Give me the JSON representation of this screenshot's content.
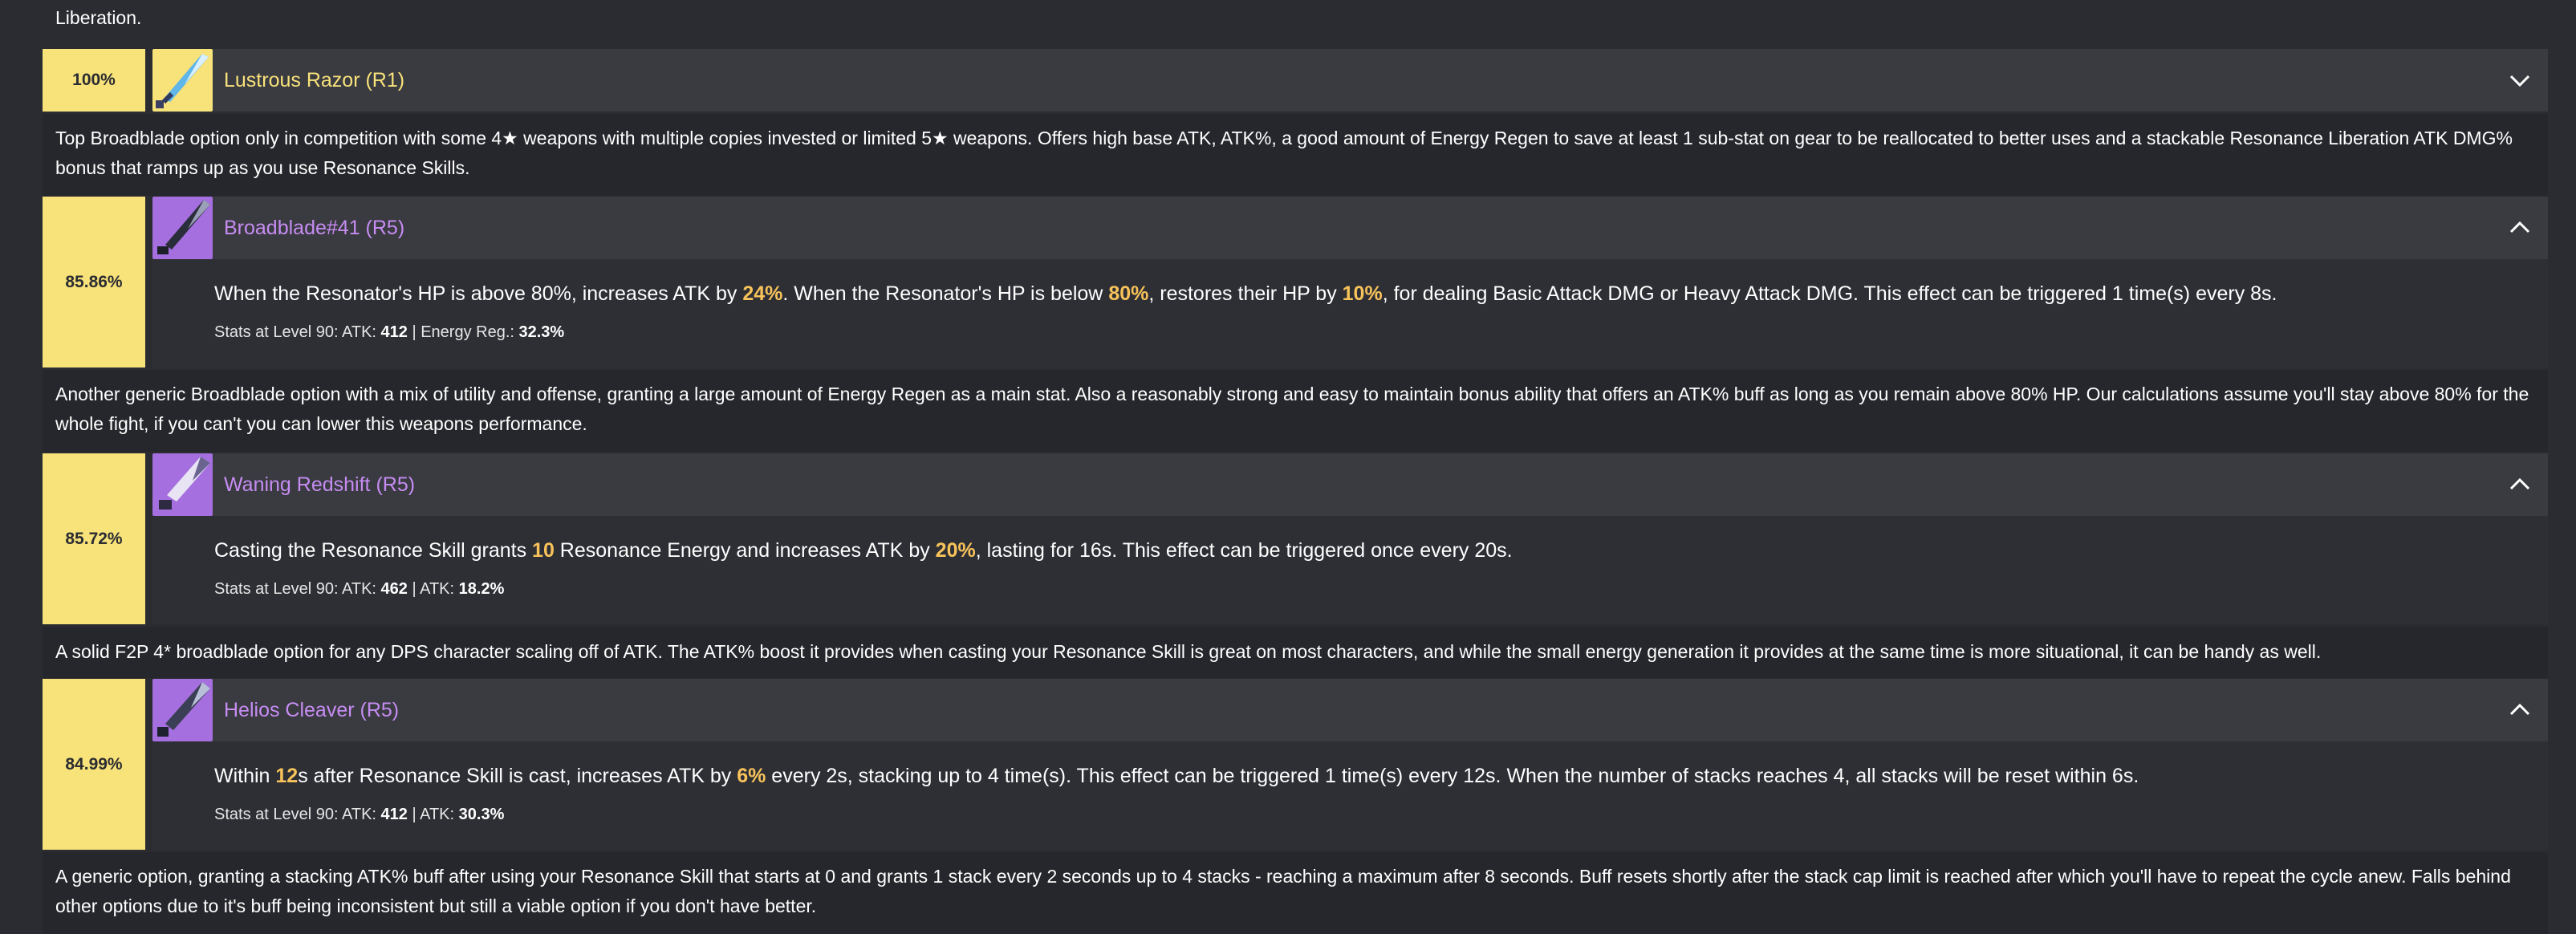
{
  "intro_tail": "Liberation.",
  "weapons": [
    {
      "percent": "100%",
      "name": "Lustrous Razor (R1)",
      "rarity": "5",
      "expanded": false,
      "effect": "",
      "description": "Top Broadblade option only in competition with some 4★ weapons with multiple copies invested or limited 5★ weapons. Offers high base ATK, ATK%, a good amount of Energy Regen to save at least 1 sub-stat on gear to be reallocated to better uses and a stackable Resonance Liberation ATK DMG% bonus that ramps up as you use Resonance Skills."
    },
    {
      "percent": "85.86%",
      "name": "Broadblade#41 (R5)",
      "rarity": "4",
      "expanded": true,
      "effect_parts": [
        "When the Resonator's HP is above 80%, increases ATK by ",
        "24%",
        ". When the Resonator's HP is below ",
        "80%",
        ", restores their HP by ",
        "10%",
        ", for dealing Basic Attack DMG or Heavy Attack DMG. This effect can be triggered 1 time(s) every 8s."
      ],
      "stats_label": "Stats at Level 90: ATK: ",
      "stat1": "412",
      "stat_sep": " | Energy Reg.: ",
      "stat2": "32.3%",
      "description": "Another generic Broadblade option with a mix of utility and offense, granting a large amount of Energy Regen as a main stat. Also a reasonably strong and easy to maintain bonus ability that offers an ATK% buff as long as you remain above 80% HP. Our calculations assume you'll stay above 80% for the whole fight, if you can't you can lower this weapons performance."
    },
    {
      "percent": "85.72%",
      "name": "Waning Redshift (R5)",
      "rarity": "4",
      "expanded": true,
      "effect_parts": [
        "Casting the Resonance Skill grants ",
        "10",
        " Resonance Energy and increases ATK by ",
        "20%",
        ", lasting for 16s. This effect can be triggered once every 20s."
      ],
      "stats_label": "Stats at Level 90: ATK: ",
      "stat1": "462",
      "stat_sep": " | ATK: ",
      "stat2": "18.2%",
      "description": "A solid F2P 4* broadblade option for any DPS character scaling off of ATK. The ATK% boost it provides when casting your Resonance Skill is great on most characters, and while the small energy generation it provides at the same time is more situational, it can be handy as well."
    },
    {
      "percent": "84.99%",
      "name": "Helios Cleaver (R5)",
      "rarity": "4",
      "expanded": true,
      "effect_parts": [
        "Within ",
        "12",
        "s after Resonance Skill is cast, increases ATK by ",
        "6%",
        " every 2s, stacking up to 4 time(s). This effect can be triggered 1 time(s) every 12s. When the number of stacks reaches 4, all stacks will be reset within 6s."
      ],
      "stats_label": "Stats at Level 90: ATK: ",
      "stat1": "412",
      "stat_sep": " | ATK: ",
      "stat2": "30.3%",
      "description": "A generic option, granting a stacking ATK% buff after using your Resonance Skill that starts at 0 and grants 1 stack every 2 seconds up to 4 stacks - reaching a maximum after 8 seconds. Buff resets shortly after the stack cap limit is reached after which you'll have to repeat the cycle anew. Falls behind other options due to it's buff being inconsistent but still a viable option if you don't have better."
    }
  ],
  "icons": {
    "collapsed": "chevron-down-icon",
    "expanded": "chevron-up-icon",
    "weapon": "broadblade-icon"
  },
  "colors": {
    "score_bg": "#f8e27a",
    "gold_name": "#f8e27a",
    "purple_name": "#c68cf2",
    "highlight": "#f8c35a",
    "header_bg": "#3a3b41"
  }
}
